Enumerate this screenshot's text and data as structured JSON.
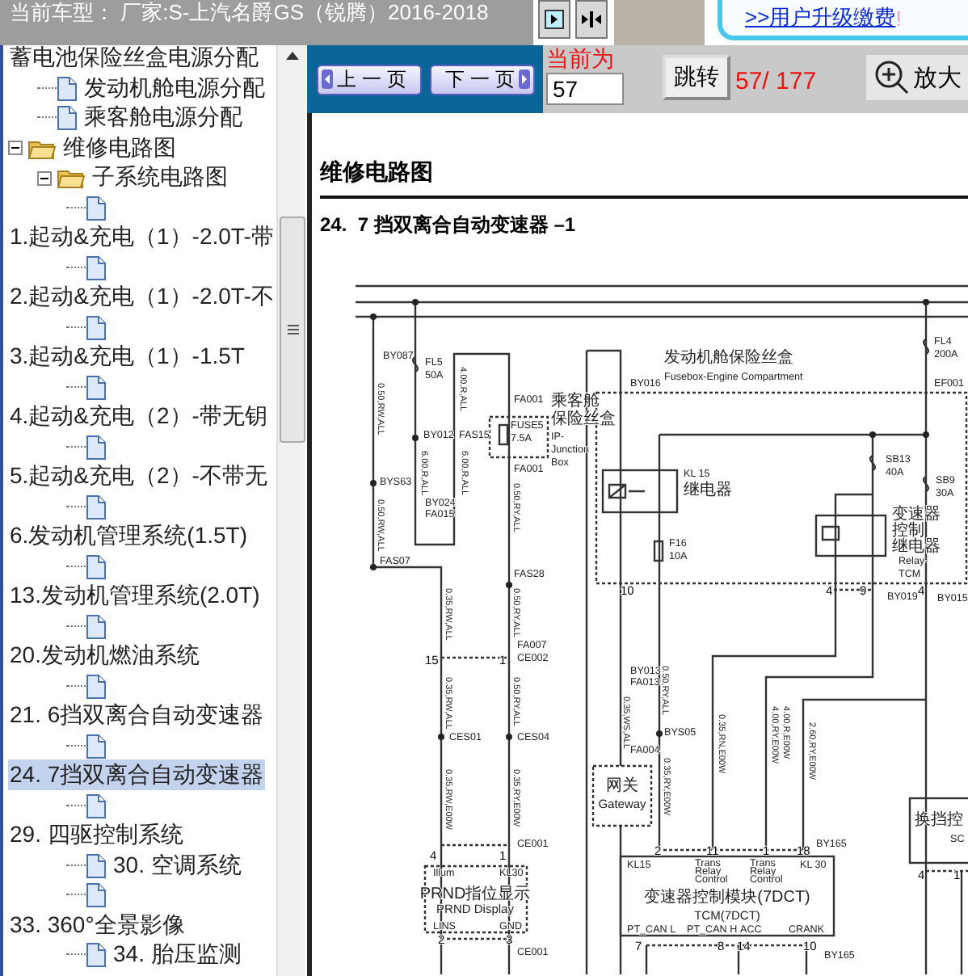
{
  "header": {
    "title": "当前车型：  厂家:S-上汽名爵GS（锐腾）2016-2018",
    "upgrade_link": ">>用户升级缴费",
    "upgrade_mark": "!"
  },
  "tree": [
    {
      "kind": "text",
      "label": "蓄电池保险丝盒电源分配",
      "children": [
        {
          "kind": "doc",
          "label": "发动机舱电源分配",
          "selected": false
        },
        {
          "kind": "doc",
          "label": "乘客舱电源分配",
          "selected": false
        }
      ]
    },
    {
      "kind": "folder",
      "label": "维修电路图",
      "expanded": true,
      "children": [
        {
          "kind": "folder",
          "label": "子系统电路图",
          "expanded": true,
          "children": [
            {
              "kind": "doc",
              "label": "1.起动&充电（1）-2.0T-带",
              "selected": false
            },
            {
              "kind": "doc",
              "label": "2.起动&充电（1）-2.0T-不",
              "selected": false
            },
            {
              "kind": "doc",
              "label": "3.起动&充电（1）-1.5T",
              "selected": false
            },
            {
              "kind": "doc",
              "label": "4.起动&充电（2）-带无钥",
              "selected": false
            },
            {
              "kind": "doc",
              "label": "5.起动&充电（2）-不带无",
              "selected": false
            },
            {
              "kind": "doc",
              "label": "6.发动机管理系统(1.5T)",
              "selected": false
            },
            {
              "kind": "doc",
              "label": "13.发动机管理系统(2.0T)",
              "selected": false
            },
            {
              "kind": "doc",
              "label": "20.发动机燃油系统",
              "selected": false
            },
            {
              "kind": "doc",
              "label": "21. 6挡双离合自动变速器",
              "selected": false
            },
            {
              "kind": "doc",
              "label": "24. 7挡双离合自动变速器",
              "selected": true
            },
            {
              "kind": "doc",
              "label": "29. 四驱控制系统",
              "selected": false
            },
            {
              "kind": "doc",
              "label": "30. 空调系统",
              "selected": false
            },
            {
              "kind": "doc",
              "label": "33. 360°全景影像",
              "selected": false
            },
            {
              "kind": "doc",
              "label": "34. 胎压监测",
              "selected": false
            }
          ]
        }
      ]
    }
  ],
  "toolbar": {
    "prev_button": "上 一 页",
    "next_button": "下 一 页",
    "current_label": "当前为",
    "page_input": "57",
    "jump_button": "跳转",
    "page_count": "57/ 177",
    "zoom_button": "放大"
  },
  "document": {
    "heading": "维修电路图",
    "title": "24.  7 挡双离合自动变速器 –1",
    "diagram_labels": [
      "BY087",
      "FL5",
      "50A",
      "0.50,RW,ALL",
      "BY012",
      "FAS15",
      "4.00,R,ALL",
      "6.00,R,ALL",
      "6.00,R,ALL",
      "FA001",
      "FUSE5",
      "7.5A",
      "乘客舱",
      "保险丝盒",
      "IP-",
      "Junction",
      "Box",
      "FA001",
      "0.50,RY,ALL",
      "BYS63",
      "BY024",
      "FA015",
      "0.50,RW,ALL",
      "发动机舱保险丝盒",
      "Fusebox-Engine Compartment",
      "BY016",
      "FL4",
      "200A",
      "EF001",
      "KL 15",
      "继电器",
      "SB13",
      "40A",
      "SB9",
      "30A",
      "变速器",
      "控制",
      "继电器",
      "Relay-",
      "TCM",
      "F16",
      "10A",
      "FAS07",
      "FAS28",
      "0.35,RW,ALL",
      "0.50,RY,ALL",
      "FA007",
      "15",
      "1",
      "CE002",
      "0.35,RW,ALL",
      "CES01",
      "0.50,RY,ALL",
      "CES04",
      "0.35,RW,E00W",
      "0.35,RY,E00W",
      "CE001",
      "4",
      "1",
      "Illum",
      "KL30",
      "PRND指位显示",
      "PRND Display",
      "LINS",
      "GND",
      "2",
      "3",
      "CE001",
      "10",
      "0.50,RY,ALL",
      "BY013",
      "FA013",
      "0.35,WS,ALL",
      "BYS05",
      "FA004",
      "网关",
      "Gateway",
      "0.35,RY,E00W",
      "BY019",
      "4",
      "9",
      "4",
      "BY015",
      "0.35,RN,E00W",
      "4.00,RY,E00W",
      "4.00,R,E00W",
      "2.60,RY,E00W",
      "BY165",
      "2",
      "11",
      "1",
      "18",
      "KL15",
      "Trans",
      "Relay",
      "Control",
      "Trans",
      "Relay",
      "Control",
      "KL 30",
      "变速器控制模块(7DCT)",
      "TCM(7DCT)",
      "PT_CAN L",
      "PT_CAN H",
      "ACC",
      "CRANK",
      "7",
      "8",
      "14",
      "10",
      "BY165",
      "换挡控",
      "SC",
      "4",
      "1"
    ]
  }
}
